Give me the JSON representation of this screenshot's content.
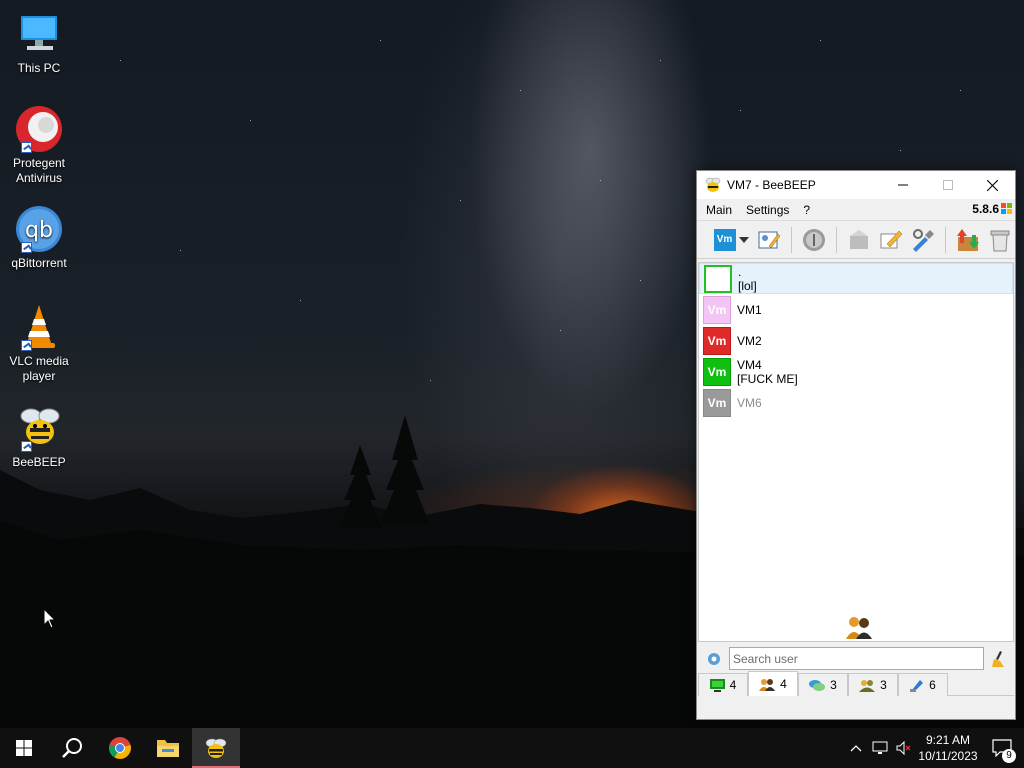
{
  "desktop": {
    "icons": [
      {
        "label": "This PC",
        "icon": "computer-icon"
      },
      {
        "label": "Protegent Antivirus",
        "icon": "protegent-icon"
      },
      {
        "label": "qBittorrent",
        "icon": "qbittorrent-icon"
      },
      {
        "label": "VLC media player",
        "icon": "vlc-icon"
      },
      {
        "label": "BeeBEEP",
        "icon": "beebeep-icon"
      }
    ]
  },
  "window": {
    "title": "VM7 - BeeBEEP",
    "menu": [
      "Main",
      "Settings",
      "?"
    ],
    "version": "5.8.6",
    "status_avatar": "Vm",
    "users": [
      {
        "line1": ".",
        "line2": "[lol]",
        "avatar_text": "",
        "color": "#ffffff",
        "border": "#22c022",
        "selected": true,
        "online": true
      },
      {
        "line1": "VM1",
        "line2": "",
        "avatar_text": "Vm",
        "color": "#f4c4f4",
        "border": "#e0a0e0",
        "selected": false,
        "online": true
      },
      {
        "line1": "VM2",
        "line2": "",
        "avatar_text": "Vm",
        "color": "#e02a2a",
        "border": "#b81818",
        "selected": false,
        "online": true
      },
      {
        "line1": "VM4",
        "line2": "[FUCK ME]",
        "avatar_text": "Vm",
        "color": "#10c010",
        "border": "#0a9a0a",
        "selected": false,
        "online": true
      },
      {
        "line1": "VM6",
        "line2": "",
        "avatar_text": "Vm",
        "color": "#9a9a9a",
        "border": "#888888",
        "selected": false,
        "online": false
      }
    ],
    "search_placeholder": "Search user",
    "tabs": [
      {
        "count": "4",
        "icon": "monitor-icon"
      },
      {
        "count": "4",
        "icon": "users-icon"
      },
      {
        "count": "3",
        "icon": "chat-icon"
      },
      {
        "count": "3",
        "icon": "groups-icon"
      },
      {
        "count": "6",
        "icon": "files-icon"
      }
    ]
  },
  "taskbar": {
    "time": "9:21 AM",
    "date": "10/11/2023",
    "notification_count": "9"
  },
  "colors": {
    "accent_selected": "#e5f1fb",
    "taskbar": "#101010"
  }
}
